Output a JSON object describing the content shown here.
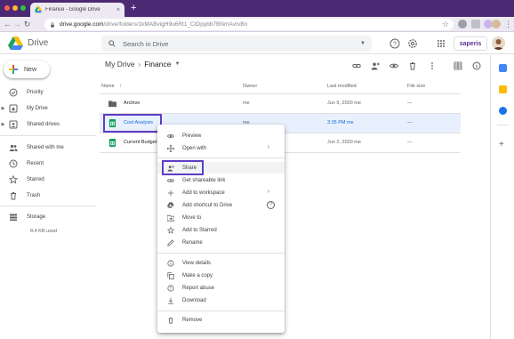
{
  "browser": {
    "tab_title": "Finance - Google Drive",
    "tab_close": "×",
    "new_tab": "+",
    "url_host": "drive.google.com",
    "url_path": "/drive/folders/1kMABvigH9u6Rt1_CtDpybb7BNmAvrvBn",
    "colors": {
      "chrome": "#4b2a73",
      "tab": "#ede9f2"
    }
  },
  "header": {
    "app_name": "Drive",
    "search_placeholder": "Search in Drive",
    "brand": "saperis",
    "icons": [
      "help-icon",
      "settings-icon",
      "apps-grid-icon"
    ]
  },
  "sidebar": {
    "new_label": "New",
    "items": [
      {
        "label": "Priority",
        "icon": "check-circle-icon"
      },
      {
        "label": "My Drive",
        "icon": "my-drive-icon"
      },
      {
        "label": "Shared drives",
        "icon": "shared-drives-icon"
      },
      {
        "label": "Shared with me",
        "icon": "people-icon"
      },
      {
        "label": "Recent",
        "icon": "clock-icon"
      },
      {
        "label": "Starred",
        "icon": "star-icon"
      },
      {
        "label": "Trash",
        "icon": "trash-icon"
      },
      {
        "label": "Storage",
        "icon": "storage-icon"
      }
    ],
    "storage_used": "8.4 KB used"
  },
  "breadcrumb": {
    "root": "My Drive",
    "separator": "›",
    "current": "Finance"
  },
  "table": {
    "columns": {
      "name": "Name",
      "owner": "Owner",
      "modified": "Last modified",
      "size": "File size"
    },
    "sort_arrow": "↑",
    "rows": [
      {
        "name": "Archive",
        "owner": "me",
        "modified": "Jun 9, 2020 me",
        "size": "—",
        "icon": "folder-icon"
      },
      {
        "name": "Cost Analysis",
        "owner": "me",
        "modified": "3:35 PM me",
        "size": "—",
        "icon": "sheets-icon",
        "selected": true
      },
      {
        "name": "Current Budget",
        "owner": "me",
        "modified": "Jun 2, 2020 me",
        "size": "—",
        "icon": "sheets-icon"
      }
    ]
  },
  "context_menu": {
    "items": [
      {
        "label": "Preview",
        "icon": "eye-icon"
      },
      {
        "label": "Open with",
        "icon": "open-with-icon",
        "submenu": true
      },
      {
        "label": "Share",
        "icon": "person-add-icon",
        "highlighted": true
      },
      {
        "label": "Get shareable link",
        "icon": "link-icon"
      },
      {
        "label": "Add to workspace",
        "icon": "plus-icon",
        "submenu": true
      },
      {
        "label": "Add shortcut to Drive",
        "icon": "shortcut-icon",
        "help": "?"
      },
      {
        "label": "Move to",
        "icon": "move-to-icon"
      },
      {
        "label": "Add to Starred",
        "icon": "star-outline-icon"
      },
      {
        "label": "Rename",
        "icon": "pencil-icon"
      },
      {
        "label": "View details",
        "icon": "info-icon"
      },
      {
        "label": "Make a copy",
        "icon": "copy-icon"
      },
      {
        "label": "Report abuse",
        "icon": "report-icon"
      },
      {
        "label": "Download",
        "icon": "download-icon"
      },
      {
        "label": "Remove",
        "icon": "trash-icon"
      }
    ],
    "submenu_arrow": "›"
  },
  "accent": "#5f3dc4",
  "selection_bg": "#e8f0fe"
}
